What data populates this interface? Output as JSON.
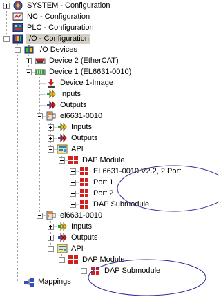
{
  "colors": {
    "annotation": "#2b2b9c",
    "selection_background": "#d4d0c8"
  },
  "tree": {
    "system": {
      "label": "SYSTEM - Configuration",
      "icon": "system-config-icon",
      "expander": "plus"
    },
    "nc": {
      "label": "NC - Configuration",
      "icon": "nc-config-icon",
      "expander": "none"
    },
    "plc": {
      "label": "PLC - Configuration",
      "icon": "plc-config-icon",
      "expander": "none"
    },
    "io": {
      "label": "I/O - Configuration",
      "icon": "io-config-icon",
      "expander": "minus",
      "selected": true
    },
    "io_devices": {
      "label": "I/O Devices",
      "icon": "io-devices-icon",
      "expander": "minus"
    },
    "device2": {
      "label": "Device 2 (EtherCAT)",
      "icon": "ethercat-device-icon",
      "expander": "plus"
    },
    "device1": {
      "label": "Device 1 (EL6631-0010)",
      "icon": "profinet-device-icon",
      "expander": "minus"
    },
    "device1_image": {
      "label": "Device 1-Image",
      "icon": "image-icon",
      "expander": "none"
    },
    "device1_inputs": {
      "label": "Inputs",
      "icon": "inputs-icon",
      "expander": "none"
    },
    "device1_outputs": {
      "label": "Outputs",
      "icon": "outputs-icon",
      "expander": "none"
    },
    "box1": {
      "label": "el6631-0010",
      "icon": "box-icon",
      "expander": "minus"
    },
    "box1_inputs": {
      "label": "Inputs",
      "icon": "inputs-icon",
      "expander": "plus"
    },
    "box1_outputs": {
      "label": "Outputs",
      "icon": "outputs-icon",
      "expander": "plus"
    },
    "box1_api": {
      "label": "API",
      "icon": "api-icon",
      "expander": "minus"
    },
    "box1_dap": {
      "label": "DAP Module",
      "icon": "module-icon",
      "expander": "minus"
    },
    "box1_dap_el": {
      "label": "EL6631-0010 V2.2, 2 Port",
      "icon": "submodule-icon",
      "expander": "plus"
    },
    "box1_port1": {
      "label": "Port 1",
      "icon": "submodule-icon",
      "expander": "plus"
    },
    "box1_port2": {
      "label": "Port 2",
      "icon": "submodule-icon",
      "expander": "plus"
    },
    "box1_dap_sub": {
      "label": "DAP Submodule",
      "icon": "submodule-icon",
      "expander": "plus"
    },
    "box2": {
      "label": "el6631-0010",
      "icon": "box-icon",
      "expander": "minus"
    },
    "box2_inputs": {
      "label": "Inputs",
      "icon": "inputs-icon",
      "expander": "plus"
    },
    "box2_outputs": {
      "label": "Outputs",
      "icon": "outputs-icon",
      "expander": "plus"
    },
    "box2_api": {
      "label": "API",
      "icon": "api-icon",
      "expander": "minus"
    },
    "box2_dap": {
      "label": "DAP Module",
      "icon": "module-icon",
      "expander": "minus"
    },
    "box2_dap_sub": {
      "label": "DAP Submodule",
      "icon": "submodule-icon",
      "expander": "plus"
    },
    "mappings": {
      "label": "Mappings",
      "icon": "mappings-icon",
      "expander": "none"
    }
  }
}
